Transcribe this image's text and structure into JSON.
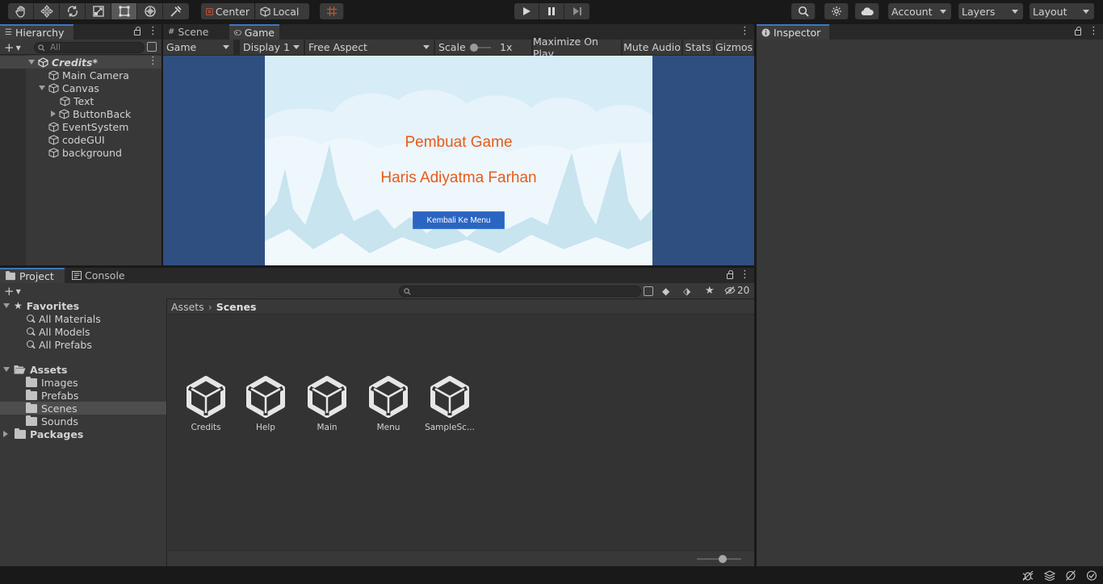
{
  "toolbar": {
    "tools": [
      "hand-tool",
      "move-tool",
      "rotate-tool",
      "scale-tool",
      "rect-tool",
      "transform-tool",
      "custom-tool"
    ],
    "pivot_label": "Center",
    "space_label": "Local",
    "account_label": "Account",
    "layers_label": "Layers",
    "layout_label": "Layout"
  },
  "hierarchy": {
    "tab_label": "Hierarchy",
    "search_placeholder": "All",
    "scene_name": "Credits*",
    "items": [
      {
        "label": "Main Camera"
      },
      {
        "label": "Canvas"
      },
      {
        "label": "Text"
      },
      {
        "label": "ButtonBack"
      },
      {
        "label": "EventSystem"
      },
      {
        "label": "codeGUI"
      },
      {
        "label": "background"
      }
    ]
  },
  "game_panel": {
    "tabs": [
      {
        "label": "Scene"
      },
      {
        "label": "Game"
      }
    ],
    "mode_label": "Game",
    "display_label": "Display 1",
    "aspect_label": "Free Aspect",
    "scale_label": "Scale",
    "scale_value": "1x",
    "maximize_label": "Maximize On Play",
    "mute_label": "Mute Audio",
    "stats_label": "Stats",
    "gizmos_label": "Gizmos",
    "game": {
      "title": "Pembuat Game",
      "author": "Haris Adiyatma Farhan",
      "button_label": "Kembali Ke Menu"
    },
    "colors": {
      "background": "#2f4f80",
      "sky": "#d6ecf7",
      "text": "#e85a19",
      "button": "#2b65c2"
    }
  },
  "inspector": {
    "tab_label": "Inspector"
  },
  "project": {
    "tabs": [
      {
        "label": "Project"
      },
      {
        "label": "Console"
      }
    ],
    "hidden_count": "20",
    "favorites": {
      "label": "Favorites",
      "items": [
        {
          "label": "All Materials"
        },
        {
          "label": "All Models"
        },
        {
          "label": "All Prefabs"
        }
      ]
    },
    "assets": {
      "label": "Assets",
      "items": [
        {
          "label": "Images"
        },
        {
          "label": "Prefabs"
        },
        {
          "label": "Scenes"
        },
        {
          "label": "Sounds"
        }
      ]
    },
    "packages_label": "Packages",
    "breadcrumb": [
      "Assets",
      "Scenes"
    ],
    "files": [
      {
        "label": "Credits"
      },
      {
        "label": "Help"
      },
      {
        "label": "Main"
      },
      {
        "label": "Menu"
      },
      {
        "label": "SampleSc..."
      }
    ]
  },
  "colors": {
    "accent": "#3a79bb",
    "panel": "#383838",
    "toolbar": "#191919"
  }
}
